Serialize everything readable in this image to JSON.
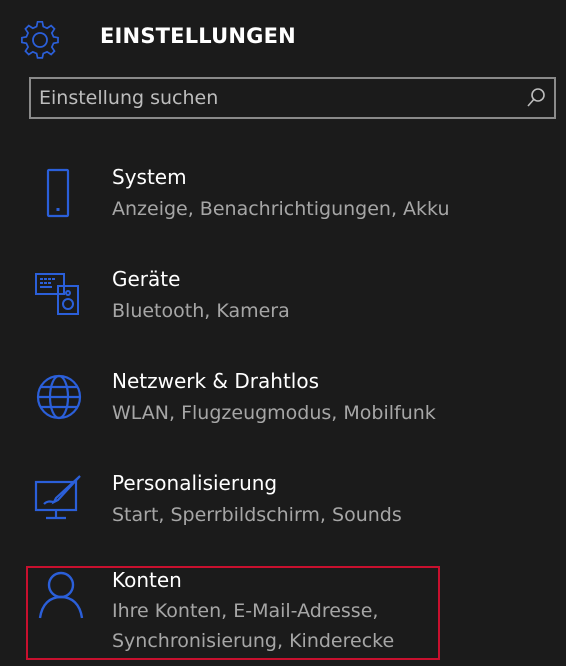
{
  "header": {
    "title": "EINSTELLUNGEN",
    "icon": "gear-icon"
  },
  "search": {
    "placeholder": "Einstellung suchen",
    "value": "",
    "icon": "search-icon"
  },
  "items": [
    {
      "label": "System",
      "sub": "Anzeige, Benachrichtigungen, Akku",
      "icon": "phone-icon"
    },
    {
      "label": "Geräte",
      "sub": "Bluetooth, Kamera",
      "icon": "devices-icon"
    },
    {
      "label": "Netzwerk & Drahtlos",
      "sub": "WLAN, Flugzeugmodus, Mobilfunk",
      "icon": "globe-icon"
    },
    {
      "label": "Personalisierung",
      "sub": "Start, Sperrbildschirm, Sounds",
      "icon": "personalization-icon"
    },
    {
      "label": "Konten",
      "sub_line1": "Ihre Konten, E-Mail-Adresse,",
      "sub_line2": "Synchronisierung, Kinderecke",
      "icon": "person-icon"
    }
  ],
  "colors": {
    "accent": "#2b5fd9",
    "background": "#1b1b1b",
    "highlight_border": "#c8102e",
    "secondary_text": "#a6a6a6"
  }
}
